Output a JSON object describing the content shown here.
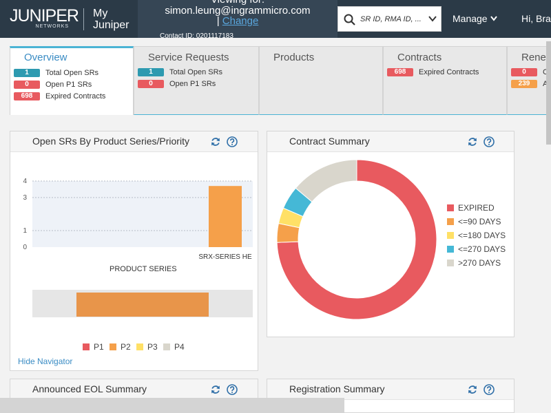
{
  "header": {
    "brand": "JUNIPER",
    "brand_sub": "NETWORKS",
    "portal_line1": "My",
    "portal_line2": "Juniper",
    "viewing_for": "Viewing for:",
    "viewing_email": "simon.leung@ingrammicro.com",
    "change_prefix": "|",
    "change_link": "Change",
    "contact_id": "Contact ID: 0201117183",
    "search_placeholder": "SR ID, RMA ID, ...",
    "manage_label": "Manage",
    "greeting": "Hi, Bra"
  },
  "tabs": [
    {
      "title": "Overview",
      "rows": [
        {
          "value": "1",
          "label": "Total Open SRs",
          "color": "teal"
        },
        {
          "value": "0",
          "label": "Open P1 SRs",
          "color": "red"
        },
        {
          "value": "698",
          "label": "Expired Contracts",
          "color": "red"
        }
      ]
    },
    {
      "title": "Service Requests",
      "rows": [
        {
          "value": "1",
          "label": "Total Open SRs",
          "color": "teal"
        },
        {
          "value": "0",
          "label": "Open P1 SRs",
          "color": "red"
        }
      ]
    },
    {
      "title": "Products",
      "rows": []
    },
    {
      "title": "Contracts",
      "rows": [
        {
          "value": "698",
          "label": "Expired Contracts",
          "color": "red"
        }
      ]
    },
    {
      "title": "Renew",
      "rows": [
        {
          "value": "0",
          "label": "C",
          "color": "red"
        },
        {
          "value": "239",
          "label": "A",
          "color": "orange"
        }
      ]
    }
  ],
  "panels": {
    "open_srs": {
      "title": "Open SRs By Product Series/Priority",
      "x_title": "PRODUCT SERIES",
      "hide_navigator": "Hide Navigator"
    },
    "contract_summary": {
      "title": "Contract Summary"
    },
    "eol": {
      "title": "Announced EOL Summary"
    },
    "registration": {
      "title": "Registration Summary"
    }
  },
  "colors": {
    "header_bg": "#2b3a47",
    "accent": "#4ab3d4",
    "p1": "#e85a5f",
    "p2": "#f5a04a",
    "p3": "#ffe066",
    "p4": "#d9d6cc",
    "expired": "#e85a5f",
    "d90": "#f5a04a",
    "d180": "#ffe066",
    "d270": "#45b8d6",
    "d270plus": "#d9d6cc"
  },
  "chart_data": [
    {
      "type": "bar",
      "categories": [
        "SRX-SERIES HE"
      ],
      "values": [
        3.7
      ],
      "ylim": [
        0,
        4
      ],
      "yticks": [
        "0",
        "1",
        "3",
        "4"
      ],
      "xlabel": "PRODUCT SERIES",
      "legend": [
        "P1",
        "P2",
        "P3",
        "P4"
      ],
      "grid": true
    },
    {
      "type": "pie",
      "labels": [
        "EXPIRED",
        "<=90 DAYS",
        "<=180 DAYS",
        "<=270 DAYS",
        ">270 DAYS"
      ],
      "values": [
        698,
        36,
        30,
        44,
        130
      ],
      "legend": "right"
    }
  ]
}
